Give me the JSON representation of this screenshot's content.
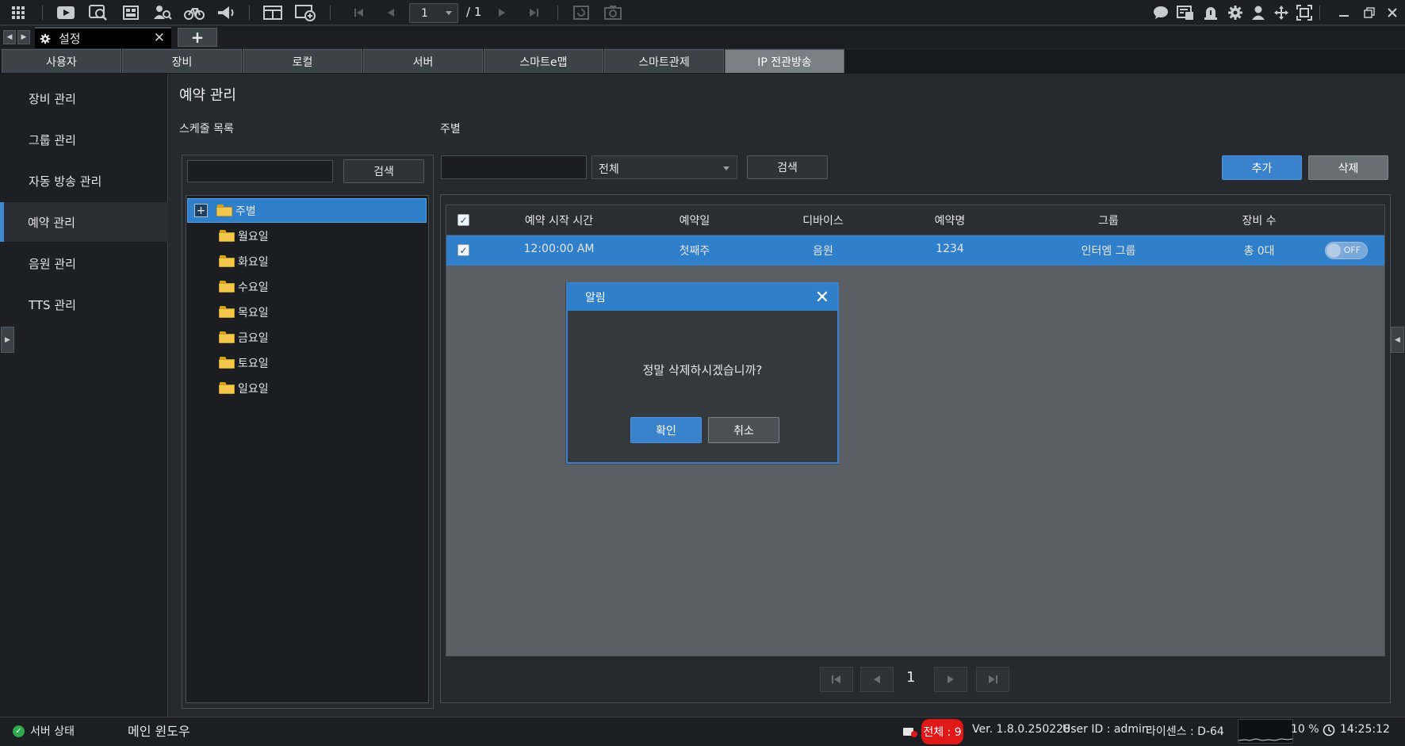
{
  "toolbar": {
    "icons": [
      "grid-icon",
      "play-icon",
      "search-video-icon",
      "layout-icon",
      "find-person-icon",
      "bicycle-icon",
      "broadcast-icon",
      "screen-layout-icon",
      "add-screen-icon",
      "first-page-icon",
      "prev-page-icon",
      "next-page-icon",
      "last-page-icon",
      "refresh-icon",
      "camera-refresh-icon",
      "chat-icon",
      "notification-icon",
      "alarm-icon",
      "settings-icon",
      "user-icon",
      "move-icon",
      "fullscreen-icon",
      "minimize-icon",
      "restore-icon",
      "close-icon"
    ],
    "page_current": "1",
    "page_total": "/ 1"
  },
  "tabs": {
    "doc_title": "설정",
    "new_tab": "+"
  },
  "main_tabs": [
    "사용자",
    "장비",
    "로컬",
    "서버",
    "스마트e맵",
    "스마트관제",
    "IP 전관방송"
  ],
  "main_tab_active": "IP 전관방송",
  "sidebar": {
    "items": [
      "장비 관리",
      "그룹 관리",
      "자동 방송 관리",
      "예약 관리",
      "음원 관리",
      "TTS 관리"
    ],
    "active": "예약 관리"
  },
  "page": {
    "title": "예약 관리",
    "schedule_list_label": "스케줄 목록",
    "weekly_label": "주별",
    "left_search_value": "",
    "left_search_button": "검색",
    "right_search_value": "",
    "filter_select": "전체",
    "right_search_button": "검색",
    "add_button": "추가",
    "delete_button": "삭제"
  },
  "tree": {
    "root": "주별",
    "expander": "+",
    "children": [
      "월요일",
      "화요일",
      "수요일",
      "목요일",
      "금요일",
      "토요일",
      "일요일"
    ]
  },
  "grid": {
    "headers": [
      "예약 시작 시간",
      "예약일",
      "디바이스",
      "예약명",
      "그룹",
      "장비 수"
    ],
    "rows": [
      {
        "start": "12:00:00 AM",
        "day": "첫째주",
        "device": "음원",
        "name": "1234",
        "group": "인터엠 그룹",
        "count": "총 0대",
        "toggle": "OFF",
        "checked": true
      }
    ],
    "check_mark": "✓"
  },
  "pagination": {
    "current": "1"
  },
  "dialog": {
    "title": "알림",
    "message": "정말 삭제하시겠습니까?",
    "confirm": "확인",
    "cancel": "취소",
    "close": "✕"
  },
  "status": {
    "server_status": "서버 상태",
    "main_window": "메인 윈도우",
    "all_count": "전체 : 9",
    "version": "Ver. 1.8.0.250228",
    "user_id": "User ID : admin",
    "license": "라이센스 : D-64",
    "cpu": "10 %",
    "time": "14:25:12"
  },
  "colors": {
    "accent": "#2f7fcb",
    "alert_red": "#e01818",
    "ok_green": "#2fa84f"
  }
}
